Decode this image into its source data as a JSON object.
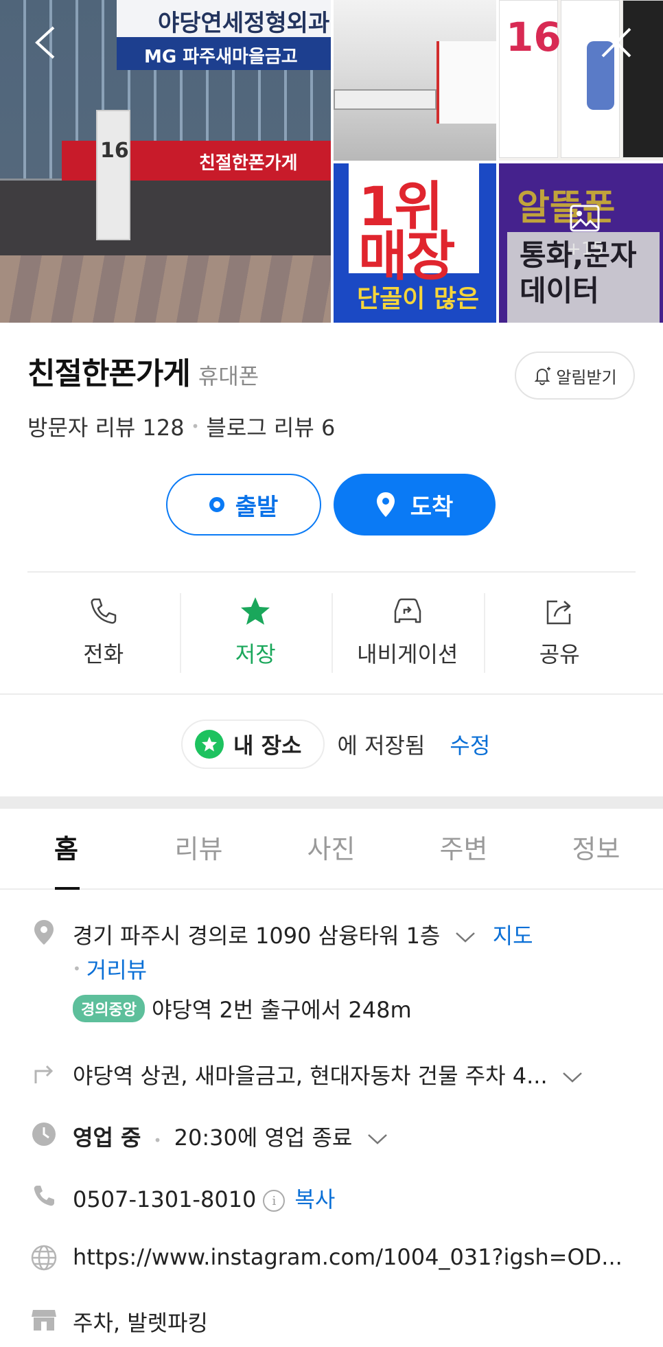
{
  "gallery": {
    "photo_texts": {
      "main_sign_top": "야당연세정형외과",
      "main_sign_bank": "MG 파주새마을금고",
      "main_shop_sign": "친절한폰가게",
      "main_banner": "16",
      "iphone_number": "16",
      "promo_1": "1위\n매장",
      "promo_1_sub": "단골이 많은",
      "promo_2_title": "알뜰폰",
      "promo_2_body": "통화,문자\n데이터"
    },
    "more_count": "+15"
  },
  "place": {
    "name": "친절한폰가게",
    "category": "휴대폰",
    "alarm_label": "알림받기",
    "visitor_review": "방문자 리뷰 128",
    "blog_review": "블로그 리뷰 6"
  },
  "route": {
    "start_label": "출발",
    "arrive_label": "도착"
  },
  "actions": [
    {
      "label": "전화",
      "icon": "phone-icon"
    },
    {
      "label": "저장",
      "icon": "star-icon"
    },
    {
      "label": "내비게이션",
      "icon": "car-navigation-icon"
    },
    {
      "label": "공유",
      "icon": "share-icon"
    }
  ],
  "saved": {
    "chip_label": "내 장소",
    "text": "에 저장됨",
    "edit_label": "수정"
  },
  "tabs": [
    "홈",
    "리뷰",
    "사진",
    "주변",
    "정보"
  ],
  "info": {
    "address": "경기 파주시 경의로 1090 삼융타워 1층",
    "map_link": "지도",
    "street_view_link": "거리뷰",
    "subway_line": "경의중앙",
    "subway_text": "야당역 2번 출구에서 248m",
    "directions": "야당역 상권, 새마을금고, 현대자동차 건물 주차 4...",
    "status": "영업 중",
    "hours": "20:30에 영업 종료",
    "phone": "0507-1301-8010",
    "copy_label": "복사",
    "website": "https://www.instagram.com/1004_031?igsh=OD...",
    "facilities": "주차, 발렛파킹"
  },
  "colors": {
    "accent_blue": "#0a7af5",
    "saved_green": "#1dc25f",
    "subway_line_green": "#5dbf9b",
    "link_blue": "#0a6fd6"
  }
}
